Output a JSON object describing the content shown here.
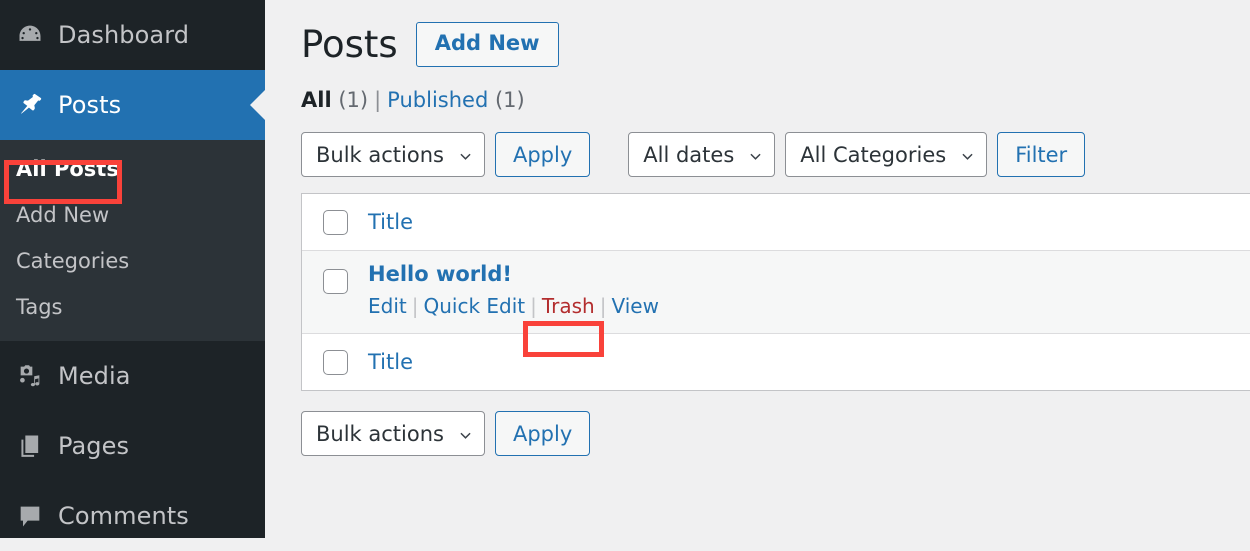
{
  "sidebar": {
    "items": [
      {
        "label": "Dashboard",
        "icon": "dashboard-icon",
        "current": false
      },
      {
        "label": "Posts",
        "icon": "pin-icon",
        "current": true
      },
      {
        "label": "Media",
        "icon": "media-icon",
        "current": false
      },
      {
        "label": "Pages",
        "icon": "pages-icon",
        "current": false
      },
      {
        "label": "Comments",
        "icon": "comments-icon",
        "current": false
      }
    ],
    "submenu": [
      {
        "label": "All Posts",
        "current": true
      },
      {
        "label": "Add New",
        "current": false
      },
      {
        "label": "Categories",
        "current": false
      },
      {
        "label": "Tags",
        "current": false
      }
    ]
  },
  "header": {
    "title": "Posts",
    "add_new_label": "Add New"
  },
  "views": {
    "all_label": "All",
    "all_count": "(1)",
    "separator": "|",
    "published_label": "Published",
    "published_count": "(1)"
  },
  "tablenav_top": {
    "bulk_actions_label": "Bulk actions",
    "apply_label": "Apply",
    "all_dates_label": "All dates",
    "all_categories_label": "All Categories",
    "filter_label": "Filter"
  },
  "tablenav_bottom": {
    "bulk_actions_label": "Bulk actions",
    "apply_label": "Apply"
  },
  "table": {
    "column_header_title": "Title",
    "column_footer_title": "Title",
    "rows": [
      {
        "title": "Hello world!",
        "actions": {
          "edit": "Edit",
          "quick_edit": "Quick Edit",
          "trash": "Trash",
          "view": "View"
        }
      }
    ]
  },
  "highlights": {
    "color": "#f9423a",
    "targets": [
      "All Posts",
      "Trash"
    ]
  },
  "colors": {
    "sidebar_bg": "#1d2327",
    "submenu_bg": "#2c3338",
    "accent_blue": "#2271b1",
    "page_bg": "#f0f0f1",
    "trash_red": "#b32d2e",
    "highlight_red": "#f9423a"
  }
}
